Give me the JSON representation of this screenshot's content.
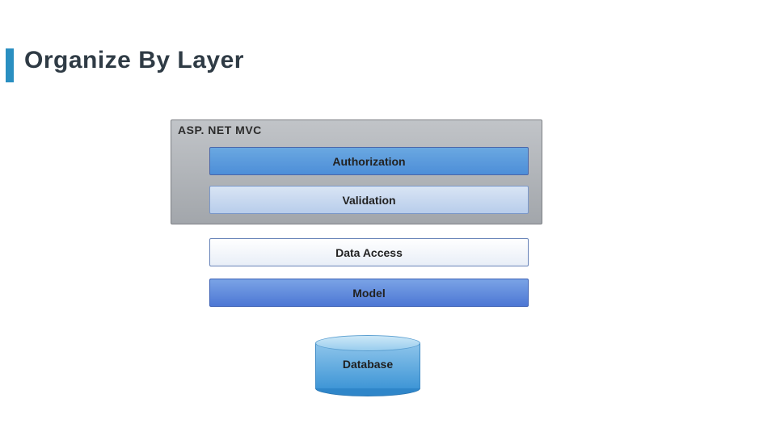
{
  "title": "Organize By Layer",
  "container": {
    "label": "ASP. NET MVC"
  },
  "layers": [
    {
      "label": "Authorization"
    },
    {
      "label": "Validation"
    },
    {
      "label": "Data Access"
    },
    {
      "label": "Model"
    }
  ],
  "database": {
    "label": "Database"
  }
}
